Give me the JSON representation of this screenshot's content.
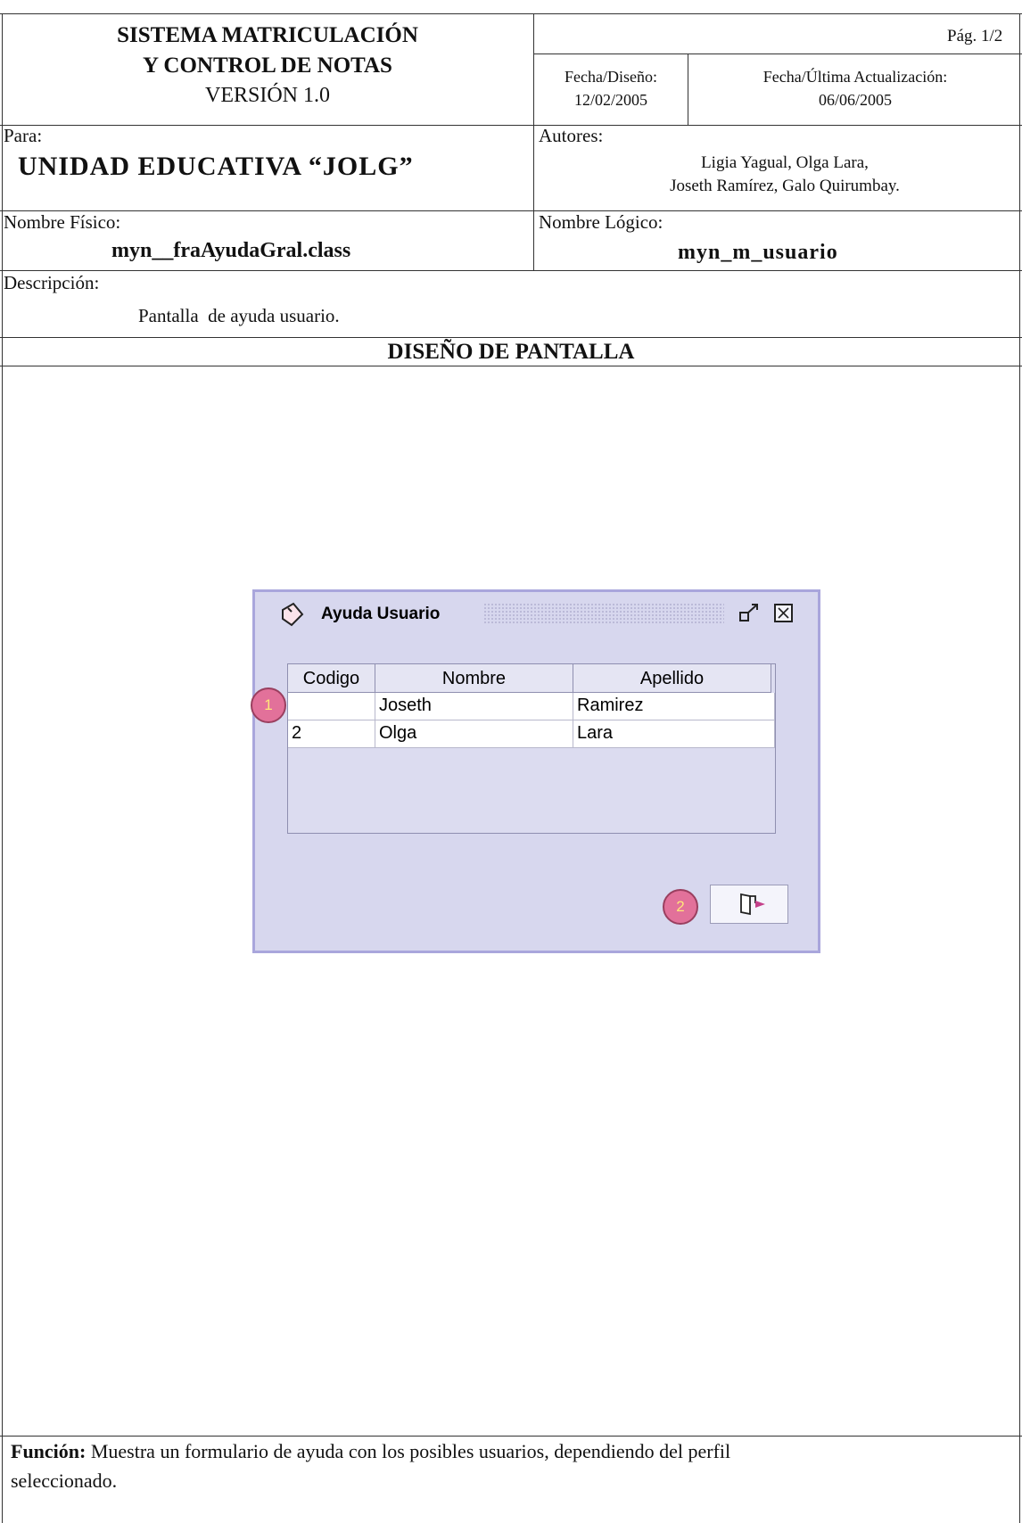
{
  "header": {
    "system_line1": "SISTEMA MATRICULACIÓN",
    "system_line2": "Y CONTROL DE NOTAS",
    "version": "VERSIÓN 1.0",
    "page": "Pág. 1/2",
    "design_date_label": "Fecha/Diseño:",
    "design_date": "12/02/2005",
    "update_date_label": "Fecha/Última Actualización:",
    "update_date": "06/06/2005"
  },
  "for_label": "Para:",
  "institution": "UNIDAD EDUCATIVA “JOLG”",
  "authors_label": "Autores:",
  "authors_line1": "Ligia Yagual, Olga Lara,",
  "authors_line2": "Joseth Ramírez, Galo Quirumbay.",
  "physical_name_label": "Nombre Físico:",
  "physical_name": "myn__fraAyudaGral.class",
  "logical_name_label": "Nombre Lógico:",
  "logical_name": "myn_m_usuario",
  "description_label": "Descripción:",
  "description": "Pantalla  de ayuda usuario.",
  "section_title": "DISEÑO DE PANTALLA",
  "window": {
    "title": "Ayuda Usuario",
    "columns": [
      "Codigo",
      "Nombre",
      "Apellido"
    ],
    "rows": [
      {
        "codigo": "",
        "nombre": "Joseth",
        "apellido": "Ramirez"
      },
      {
        "codigo": "2",
        "nombre": "Olga",
        "apellido": "Lara"
      }
    ],
    "markers": [
      "1",
      "2"
    ]
  },
  "function_label": "Función:",
  "function_text": " Muestra un formulario de ayuda con los posibles usuarios, dependiendo del perfil",
  "function_text2": "seleccionado."
}
